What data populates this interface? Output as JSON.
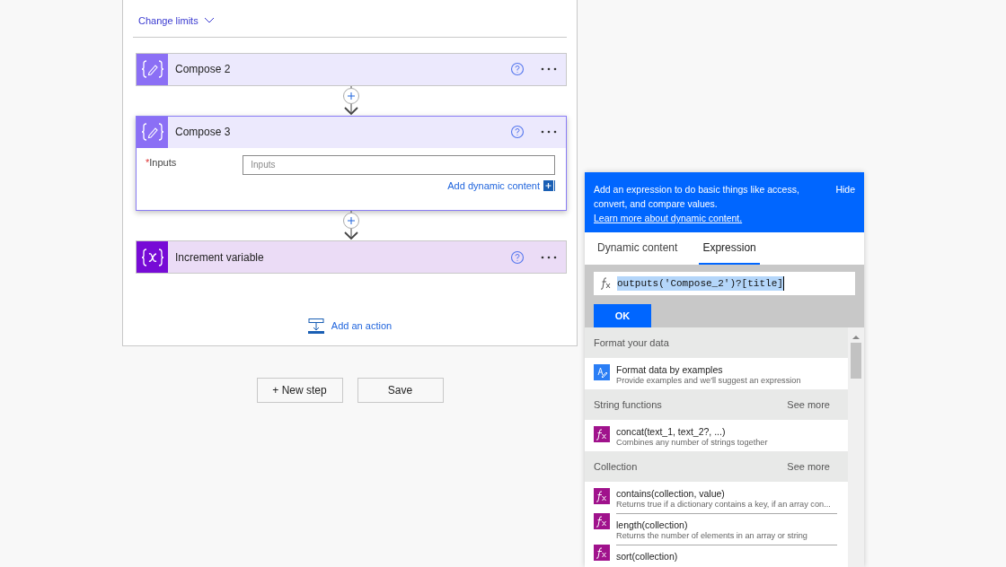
{
  "limits": {
    "label": "Change limits"
  },
  "steps": [
    {
      "kind": "compose",
      "title": "Compose 2",
      "selected": false
    },
    {
      "kind": "compose",
      "title": "Compose 3",
      "selected": true,
      "field": {
        "required_mark": "*",
        "label": "Inputs",
        "placeholder": "Inputs"
      },
      "dynamic_link": "Add dynamic content"
    },
    {
      "kind": "variable",
      "title": "Increment variable",
      "selected": false
    }
  ],
  "add_action": "Add an action",
  "buttons": [
    "+ New step",
    "Save"
  ],
  "popup": {
    "info": "Add an expression to do basic things like access, convert, and compare values.",
    "learn_link": "Learn more about dynamic content.",
    "hide": "Hide",
    "tabs": [
      {
        "label": "Dynamic content",
        "selected": false
      },
      {
        "label": "Expression",
        "selected": true
      }
    ],
    "expression": "outputs('Compose_2')?[title]",
    "ok": "OK",
    "sections": [
      {
        "title": "Format your data",
        "items": [
          {
            "kind": "format",
            "name": "Format data by examples",
            "description": "Provide examples and we'll suggest an expression"
          }
        ]
      },
      {
        "title": "String functions",
        "see_more": "See more",
        "items": [
          {
            "kind": "function",
            "name": "concat(text_1, text_2?, ...)",
            "description": "Combines any number of strings together"
          }
        ]
      },
      {
        "title": "Collection",
        "see_more": "See more",
        "items": [
          {
            "kind": "function",
            "name": "contains(collection, value)",
            "description": "Returns true if a dictionary contains a key, if an array con..."
          },
          {
            "kind": "function",
            "name": "length(collection)",
            "description": "Returns the number of elements in an array or string"
          },
          {
            "kind": "function",
            "name": "sort(collection)"
          }
        ]
      }
    ]
  }
}
